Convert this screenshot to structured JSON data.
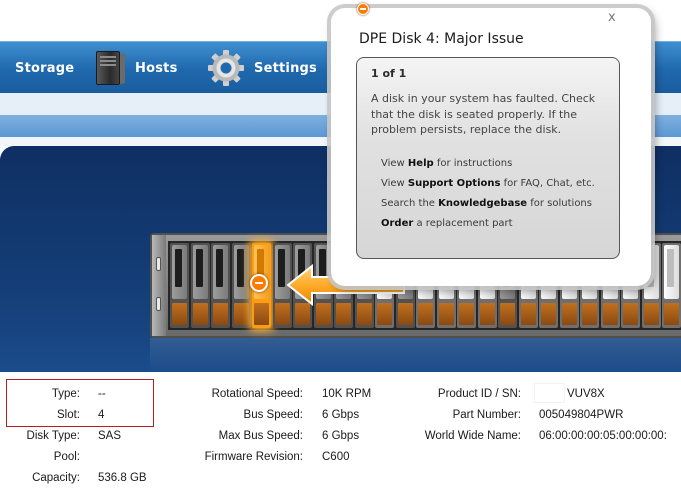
{
  "nav": {
    "storage_label": "Storage",
    "hosts_label": "Hosts",
    "settings_label": "Settings"
  },
  "popup": {
    "title": "DPE Disk 4: Major Issue",
    "count": "1 of 1",
    "message": "A disk in your system has faulted. Check that the disk is seated properly. If the problem persists, replace the disk.",
    "close": "x",
    "links": [
      {
        "pre": "View ",
        "bold": "Help",
        "post": " for instructions"
      },
      {
        "pre": "View ",
        "bold": "Support Options",
        "post": " for FAQ, Chat, etc."
      },
      {
        "pre": "Search the ",
        "bold": "Knowledgebase",
        "post": " for solutions"
      },
      {
        "pre": "",
        "bold": "Order",
        "post": " a replacement part"
      }
    ]
  },
  "enclosure": {
    "faulted_slot": 4,
    "disks": [
      "gray",
      "gray",
      "gray",
      "gray",
      "faulted",
      "gray",
      "gray",
      "gray",
      "gray",
      "gray",
      "white",
      "gray",
      "white",
      "white",
      "white",
      "white",
      "gray",
      "white",
      "white",
      "white",
      "white",
      "white",
      "white",
      "white",
      "white"
    ]
  },
  "properties": {
    "type_label": "Type:",
    "type_value": "--",
    "slot_label": "Slot:",
    "slot_value": "4",
    "disk_type_label": "Disk Type:",
    "disk_type_value": "SAS",
    "pool_label": "Pool:",
    "pool_value": "",
    "capacity_label": "Capacity:",
    "capacity_value": "536.8 GB",
    "rotational_speed_label": "Rotational Speed:",
    "rotational_speed_value": "10K RPM",
    "bus_speed_label": "Bus Speed:",
    "bus_speed_value": "6 Gbps",
    "max_bus_speed_label": "Max Bus Speed:",
    "max_bus_speed_value": "6 Gbps",
    "firmware_revision_label": "Firmware Revision:",
    "firmware_revision_value": "C600",
    "product_id_label": "Product ID / SN:",
    "product_id_value": "VUV8X",
    "part_number_label": "Part Number:",
    "part_number_value": "005049804PWR",
    "wwn_label": "World Wide Name:",
    "wwn_value": "06:00:00:00:05:00:00:00:"
  }
}
